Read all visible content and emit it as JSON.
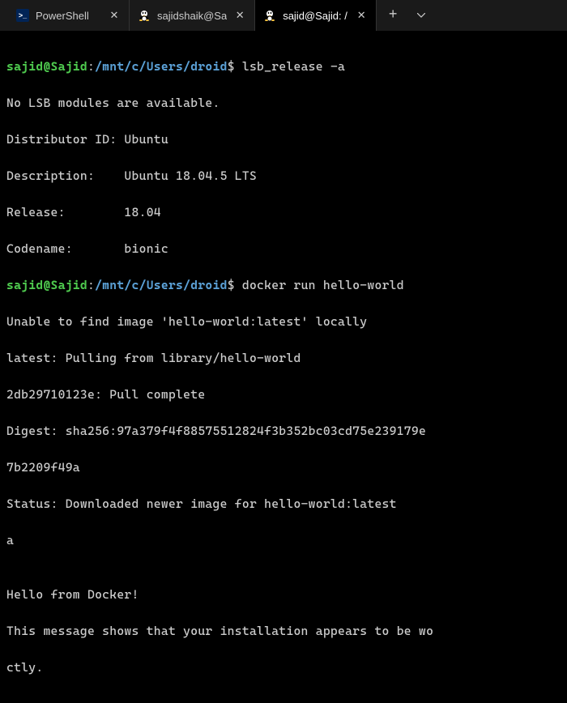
{
  "tabs": [
    {
      "label": "PowerShell",
      "icon": "powershell"
    },
    {
      "label": "sajidshaik@Sa",
      "icon": "tux"
    },
    {
      "label": "sajid@Sajid: /",
      "icon": "tux"
    }
  ],
  "prompt1": {
    "userhost": "sajid@Sajid",
    "colon": ":",
    "path": "/mnt/c/Users/droid",
    "dollar": "$",
    "command": "lsb_release -a"
  },
  "output1": {
    "l1": "No LSB modules are available.",
    "l2": "Distributor ID: Ubuntu",
    "l3": "Description:    Ubuntu 18.04.5 LTS",
    "l4": "Release:        18.04",
    "l5": "Codename:       bionic"
  },
  "prompt2": {
    "userhost": "sajid@Sajid",
    "colon": ":",
    "path": "/mnt/c/Users/droid",
    "dollar": "$",
    "command": "docker run hello-world"
  },
  "output2": {
    "l1": "Unable to find image 'hello-world:latest' locally",
    "l2": "latest: Pulling from library/hello-world",
    "l3": "2db29710123e: Pull complete",
    "l4": "Digest: sha256:97a379f4f88575512824f3b352bc03cd75e239179e",
    "l5": "7b2209f49a",
    "l6": "Status: Downloaded newer image for hello-world:latest",
    "l7": "a",
    "l8": "",
    "l9": "Hello from Docker!",
    "l10": "This message shows that your installation appears to be wo",
    "l11": "ctly."
  }
}
